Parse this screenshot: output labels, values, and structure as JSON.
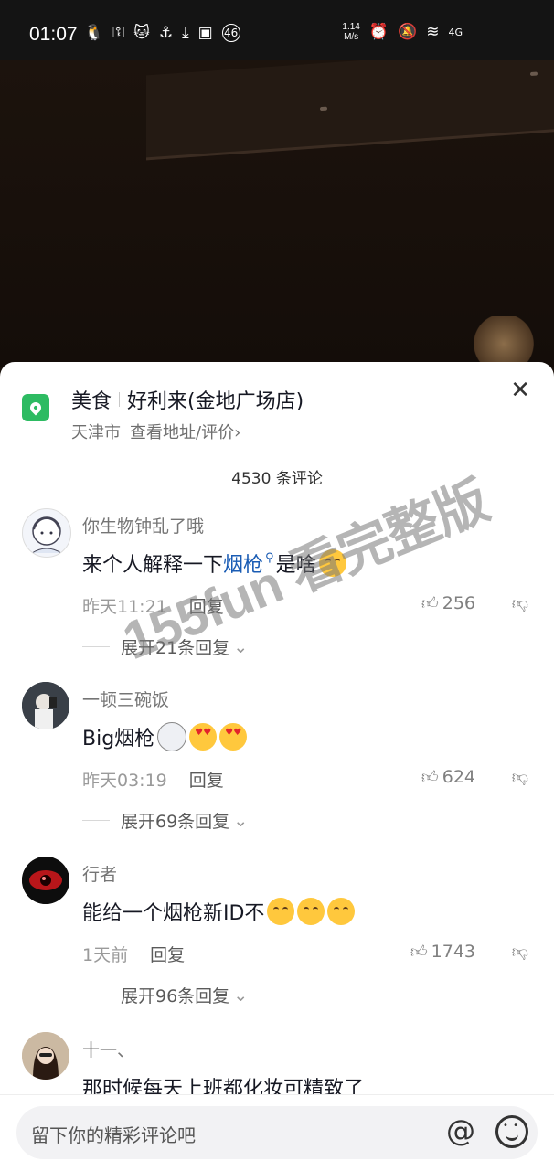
{
  "status": {
    "time": "01:07",
    "badge": "46",
    "net_speed_value": "1.14",
    "net_speed_unit": "M/s",
    "signal": "4G"
  },
  "location": {
    "category": "美食",
    "name": "好利来(金地广场店)",
    "city": "天津市",
    "link": "查看地址/评价",
    "link_arrow": "›"
  },
  "comment_count_label": "4530 条评论",
  "reply_label": "回复",
  "comments": [
    {
      "user": "你生物钟乱了哦",
      "text_pre": "来个人解释一下",
      "text_link": "烟枪",
      "text_post": "是啥",
      "emojis": [
        "crying"
      ],
      "time": "昨天11:21",
      "likes": "256",
      "expand": "展开21条回复"
    },
    {
      "user": "一顿三碗饭",
      "text_pre": "Big烟枪",
      "emojis": [
        "cat",
        "heart-eyes",
        "heart-eyes"
      ],
      "time": "昨天03:19",
      "likes": "624",
      "expand": "展开69条回复"
    },
    {
      "user": "行者",
      "text_pre": "能给一个烟枪新ID不",
      "emojis": [
        "crying",
        "crying",
        "crying"
      ],
      "time": "1天前",
      "likes": "1743",
      "expand": "展开96条回复"
    },
    {
      "user": "十一、",
      "text_pre": "那时候每天上班都化妆可精致了"
    }
  ],
  "watermark": "155fun 看完整版",
  "input": {
    "placeholder": "留下你的精彩评论吧"
  },
  "icons": {
    "location": "location-pin-icon",
    "close": "close-icon",
    "like": "thumb-up-icon",
    "dislike": "thumb-down-icon",
    "mention": "at-icon",
    "emoji": "smile-icon"
  },
  "colors": {
    "accent_green": "#2dbb62",
    "link_blue": "#1a5cb4"
  }
}
